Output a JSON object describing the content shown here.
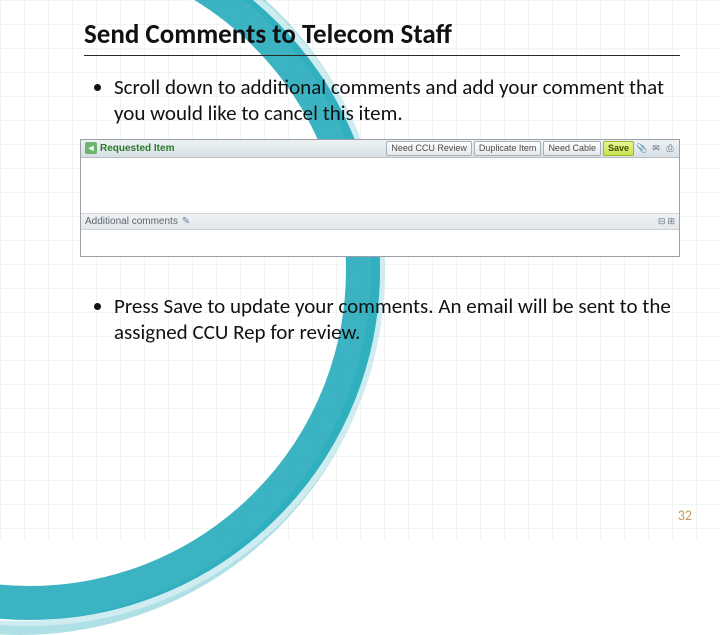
{
  "title": "Send Comments to Telecom Staff",
  "bullets": [
    "Scroll down to additional comments and add your comment that you would like to cancel this item.",
    "Press Save to update your comments. An email will be sent to the assigned CCU Rep for review."
  ],
  "screenshot": {
    "header_label": "Requested Item",
    "buttons": {
      "need_ccu": "Need CCU Review",
      "duplicate": "Duplicate Item",
      "need_cable": "Need Cable",
      "save": "Save"
    },
    "sub_label": "Additional comments"
  },
  "page_number": "32"
}
